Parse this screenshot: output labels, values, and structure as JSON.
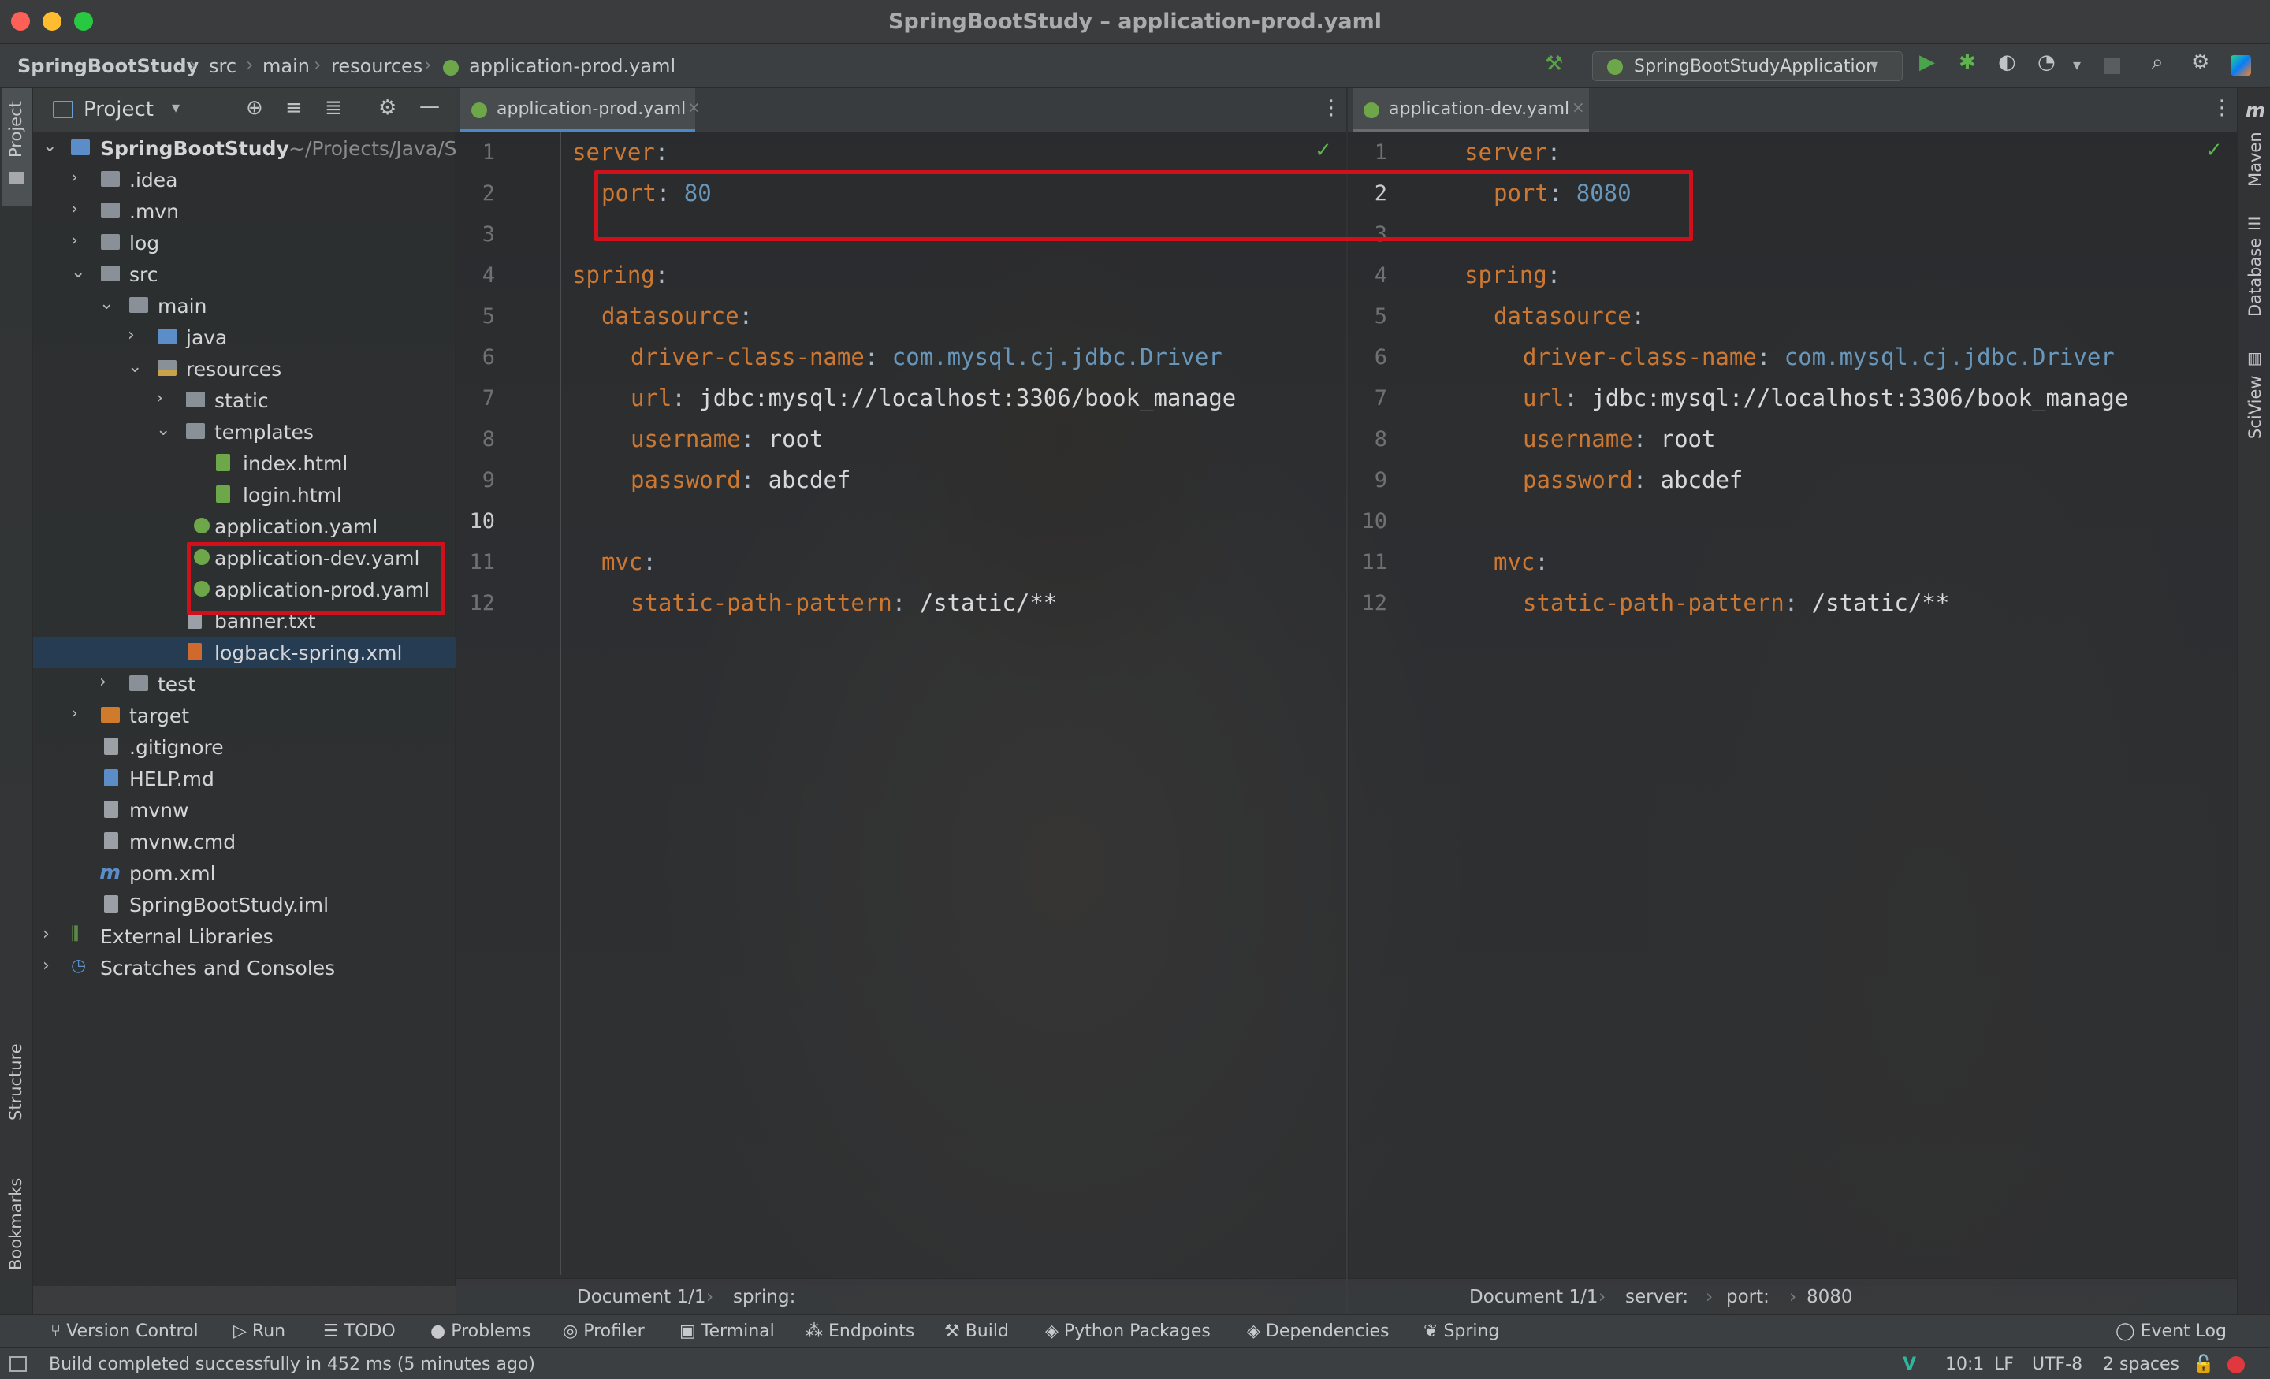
{
  "window": {
    "title": "SpringBootStudy – application-prod.yaml"
  },
  "breadcrumb": [
    "SpringBootStudy",
    "src",
    "main",
    "resources",
    "application-prod.yaml"
  ],
  "run_config": {
    "label": "SpringBootStudyApplication"
  },
  "left_stripe": {
    "project": "Project",
    "structure": "Structure",
    "bookmarks": "Bookmarks"
  },
  "right_stripe": {
    "maven": "Maven",
    "database": "Database",
    "sciview": "SciView"
  },
  "project_pane": {
    "header": "Project",
    "root": {
      "name": "SpringBootStudy",
      "path": "~/Projects/Java/S"
    },
    "items": [
      {
        "label": ".idea"
      },
      {
        "label": ".mvn"
      },
      {
        "label": "log"
      },
      {
        "label": "src"
      },
      {
        "label": "main"
      },
      {
        "label": "java"
      },
      {
        "label": "resources"
      },
      {
        "label": "static"
      },
      {
        "label": "templates"
      },
      {
        "label": "index.html"
      },
      {
        "label": "login.html"
      },
      {
        "label": "application.yaml"
      },
      {
        "label": "application-dev.yaml"
      },
      {
        "label": "application-prod.yaml"
      },
      {
        "label": "banner.txt"
      },
      {
        "label": "logback-spring.xml"
      },
      {
        "label": "test"
      },
      {
        "label": "target"
      },
      {
        "label": ".gitignore"
      },
      {
        "label": "HELP.md"
      },
      {
        "label": "mvnw"
      },
      {
        "label": "mvnw.cmd"
      },
      {
        "label": "pom.xml"
      },
      {
        "label": "SpringBootStudy.iml"
      },
      {
        "label": "External Libraries"
      },
      {
        "label": "Scratches and Consoles"
      }
    ]
  },
  "editor_left": {
    "tab": "application-prod.yaml",
    "line_numbers": [
      "1",
      "2",
      "3",
      "4",
      "5",
      "6",
      "7",
      "8",
      "9",
      "10",
      "11",
      "12"
    ],
    "code": {
      "server": "server",
      "port_key": "port",
      "port_val": "80",
      "spring": "spring",
      "datasource": "datasource",
      "driver_key": "driver-class-name",
      "driver_val": "com.mysql.cj.jdbc.Driver",
      "url_key": "url",
      "url_val": "jdbc:mysql://localhost:3306/book_manage",
      "user_key": "username",
      "user_val": "root",
      "pass_key": "password",
      "pass_val": "abcdef",
      "mvc": "mvc",
      "spp_key": "static-path-pattern",
      "spp_val": "/static/**"
    },
    "bottom_crumb": [
      "Document 1/1",
      "spring:"
    ]
  },
  "editor_right": {
    "tab": "application-dev.yaml",
    "line_numbers": [
      "1",
      "2",
      "3",
      "4",
      "5",
      "6",
      "7",
      "8",
      "9",
      "10",
      "11",
      "12"
    ],
    "code": {
      "server": "server",
      "port_key": "port",
      "port_val": "8080",
      "spring": "spring",
      "datasource": "datasource",
      "driver_key": "driver-class-name",
      "driver_val": "com.mysql.cj.jdbc.Driver",
      "url_key": "url",
      "url_val": "jdbc:mysql://localhost:3306/book_manage",
      "user_key": "username",
      "user_val": "root",
      "pass_key": "password",
      "pass_val": "abcdef",
      "mvc": "mvc",
      "spp_key": "static-path-pattern",
      "spp_val": "/static/**"
    },
    "bottom_crumb": [
      "Document 1/1",
      "server:",
      "port:",
      "8080"
    ]
  },
  "tool_windows": [
    "Version Control",
    "Run",
    "TODO",
    "Problems",
    "Profiler",
    "Terminal",
    "Endpoints",
    "Build",
    "Python Packages",
    "Dependencies",
    "Spring"
  ],
  "event_log": "Event Log",
  "status": {
    "message": "Build completed successfully in 452 ms (5 minutes ago)",
    "position": "10:1",
    "line_sep": "LF",
    "encoding": "UTF-8",
    "indent": "2 spaces"
  },
  "colors": {
    "highlight_box": "#d0101a",
    "yaml_key": "#cc7832",
    "number": "#6897bb",
    "accent": "#4a88c7"
  }
}
